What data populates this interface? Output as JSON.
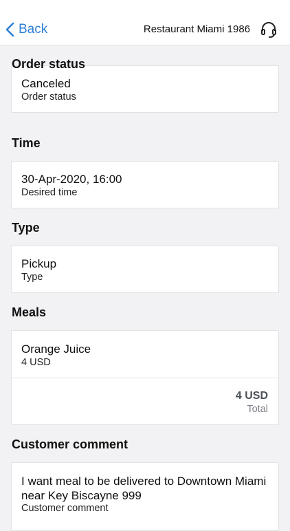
{
  "nav": {
    "back_label": "Back",
    "title": "Restaurant Miami 1986",
    "support_icon": "headset-icon",
    "accent_color": "#2f80d6"
  },
  "order_status": {
    "section_title": "Order status",
    "value": "Canceled",
    "label": "Order status"
  },
  "time": {
    "section_title": "Time",
    "value": "30-Apr-2020, 16:00",
    "label": "Desired time"
  },
  "type": {
    "section_title": "Type",
    "value": "Pickup",
    "label": "Type"
  },
  "meals": {
    "section_title": "Meals",
    "items": [
      {
        "name": "Orange Juice",
        "price": "4 USD"
      }
    ],
    "total_value": "4 USD",
    "total_label": "Total"
  },
  "comment": {
    "section_title": "Customer comment",
    "text": "I want meal to be delivered to Downtown Miami near Key Biscayne 999",
    "label": "Customer comment"
  }
}
